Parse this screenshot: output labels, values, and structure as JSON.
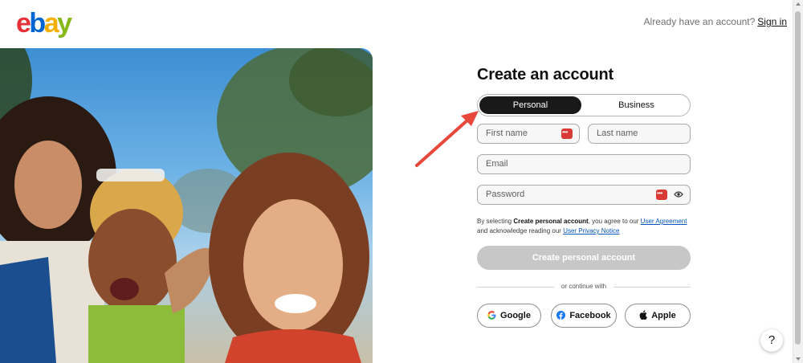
{
  "brand": {
    "logo_letters": [
      "e",
      "b",
      "a",
      "y"
    ],
    "logo_colors": [
      "#e53238",
      "#0064d2",
      "#f5af02",
      "#86b817"
    ]
  },
  "header": {
    "signin_prompt": "Already have an account?",
    "signin_link": "Sign in"
  },
  "form": {
    "title": "Create an account",
    "account_types": [
      "Personal",
      "Business"
    ],
    "selected_account_type": "Personal",
    "fields": {
      "first_name_placeholder": "First name",
      "last_name_placeholder": "Last name",
      "email_placeholder": "Email",
      "password_placeholder": "Password"
    },
    "legal": {
      "prefix": "By selecting ",
      "bold": "Create personal account",
      "middle": ", you agree to our ",
      "user_agreement": "User Agreement",
      "newline_text": "and acknowledge reading our ",
      "privacy_notice": "User Privacy Notice"
    },
    "submit_label": "Create personal account",
    "divider_text": "or continue with",
    "social": {
      "google": "Google",
      "facebook": "Facebook",
      "apple": "Apple"
    }
  },
  "help": {
    "label": "?"
  },
  "colors": {
    "password_manager_badge": "#d93a35",
    "annotation_arrow": "#e8473c",
    "link": "#0654ba",
    "disabled_button": "#c7c7c7"
  }
}
